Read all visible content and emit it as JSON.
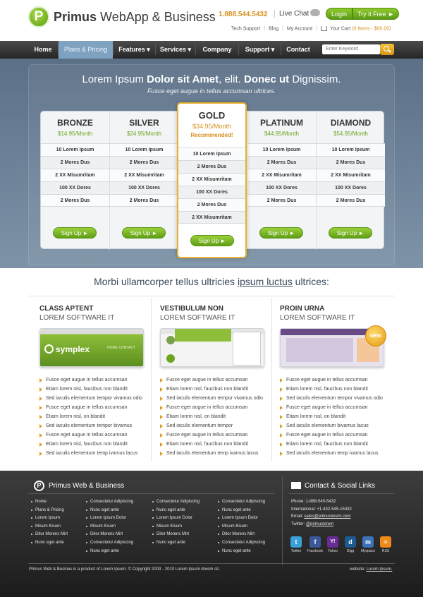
{
  "header": {
    "logo_letter": "P",
    "logo_bold": "Primus",
    "logo_rest": " WebApp & Business",
    "phone": "1.888.544.5432",
    "live_chat": "Live Chat",
    "login": "Login",
    "try_free": "Try it Free ►",
    "links": [
      "Tech Support",
      "Blog",
      "My Account"
    ],
    "cart_label": "Your Cart",
    "cart_count": "(0 Items - $00.00)"
  },
  "nav": {
    "items": [
      "Home",
      "Plans & Pricing",
      "Features ▾",
      "Services ▾",
      "Company",
      "Support ▾",
      "Contact"
    ],
    "search_placeholder": "Enter Keyword"
  },
  "hero": {
    "title_part1": "Lorem Ipsum ",
    "title_bold1": "Dolor sit Amet",
    "title_part2": ", elit. ",
    "title_bold2": "Donec ut",
    "title_part3": " Dignissim.",
    "subtitle": "Fusce eget augue in tellus accumsan ultrices."
  },
  "plans": [
    {
      "name": "BRONZE",
      "price": "$14.95/Month",
      "rows": [
        "10 Lorem Ipsum",
        "2 Mores Dus",
        "2 XX Misumritam",
        "100 XX Dores",
        "2 Mores Dus"
      ],
      "button": "Sign Up ►"
    },
    {
      "name": "SILVER",
      "price": "$24.95/Month",
      "rows": [
        "10 Lorem Ipsum",
        "2 Mores Dus",
        "2 XX Misumritam",
        "100 XX Dores",
        "2 Mores Dus"
      ],
      "button": "Sign Up ►"
    },
    {
      "name": "PLATINUM",
      "price": "$44.95/Month",
      "rows": [
        "10 Lorem Ipsum",
        "2 Mores Dus",
        "2 XX Misumritam",
        "100 XX Dores",
        "2 Mores Dus"
      ],
      "button": "Sign Up ►"
    },
    {
      "name": "DIAMOND",
      "price": "$54.95/Month",
      "rows": [
        "10 Lorem Ipsum",
        "2 Mores Dus",
        "2 XX Misumritam",
        "100 XX Dores",
        "2 Mores Dus"
      ],
      "button": "Sign Up ►"
    }
  ],
  "gold": {
    "name": "GOLD",
    "price": "$34.95/Month",
    "recommended": "Recommended!",
    "rows": [
      "10 Lorem Ipsum",
      "2 Mores Dus",
      "2 XX Misumritam",
      "100 XX Dores",
      "2 Mores Dus",
      "2 XX Misumritam"
    ],
    "button": "Sign Up ►"
  },
  "features": {
    "title_part1": "Morbi ullamcorper tellus ultricies ",
    "title_link": "ipsum luctus",
    "title_part2": " ultrices:",
    "columns": [
      {
        "h1": "CLASS APTENT",
        "h2": "LOREM SOFTWARE IT",
        "shot_brand": "symplex",
        "shot_nav": "HOME   CONTACT",
        "items": [
          "Fusce eget augue in tellus accumsan",
          "Etiam lorem nisl, faucibus non blandit",
          "Sed iaculis elementum tempor vivamus odio",
          "Fusce eget augue in tellus accumsan",
          "Etiam lorem nisl, on blandit",
          "Sed iaculis elementum tempor bivamus",
          "Fusce eget augue in tellus accumsan",
          "Etiam lorem nisl, faucibus non blandit",
          "Sed iaculis elementum temp ivamus lacus"
        ]
      },
      {
        "h1": "VESTIBULUM NON",
        "h2": "LOREM SOFTWARE IT",
        "items": [
          "Fusce eget augue in tellus accumsan",
          "Etiam lorem nisl, faucibus non blandit",
          "Sed iaculis elementum tempor vivamus odio",
          "Fusce eget augue in tellus accumsan",
          "Etiam lorem nisl, on blandit",
          "Sed iaculis elementum tempor",
          "Fusce eget augue in tellus accumsan",
          "Etiam lorem nisl, faucibus non blandit",
          "Sed iaculis elementum temp ivamus lacus"
        ]
      },
      {
        "h1": "PROIN URNA",
        "h2": "LOREM SOFTWARE IT",
        "badge": "NEW",
        "items": [
          "Fusce eget augue in tellus accumsan",
          "Etiam lorem nisl, faucibus non blandit",
          "Sed iaculis elementum tempor vivamus odio",
          "Fusce eget augue in tellus accumsan",
          "Etiam lorem nisl, on blandit",
          "Sed iaculis elementum bivamus  lacus",
          "Fusce eget augue in tellus accumsan",
          "Etiam lorem nisl, faucibus non blandit",
          "Sed iaculis elementum temp ivamus lacus"
        ]
      }
    ]
  },
  "footer": {
    "logo_letter": "P",
    "title": "Primus Web & Business",
    "contact_title": "Contact & Social Links",
    "col1": [
      "Home",
      "Plans & Pricing",
      "Lorem Ipsum",
      "Misum Kisum",
      "Ditor Morens Mirt",
      "Nunc eget ante"
    ],
    "col2": [
      "Consectetur Adipiscing",
      "Nunc eget ante",
      "Lorem Ipsum Dolor",
      "Misum Kisum",
      "Ditor Morens Mirt",
      "Consectetur Adipiscing",
      "Nunc eget ante"
    ],
    "col3": [
      "Consectetur Adipiscing",
      "Nunc eget ante",
      "Lorem Ipsum Dolor",
      "Misum Kisum",
      "Ditor Morens Mirt",
      "Nunc eget ante"
    ],
    "col4": [
      "Consectetur Adipiscing",
      "Nunc eget ante",
      "Lorem Ipsum Dolor",
      "Misum Kisum",
      "Ditor Morens Mirt",
      "Consectetur Adipiscing",
      "Nunc eget ante"
    ],
    "phone": "Phone: 1-888-545-5432",
    "international": "International: +1-432-545-15432",
    "email_label": "Email: ",
    "email": "sales@primuslorem.com",
    "twitter_label": "Twitter: ",
    "twitter": "@primuslorem",
    "social": [
      {
        "label": "Twitter",
        "glyph": "t",
        "color": "#3aa0d8"
      },
      {
        "label": "Facebook",
        "glyph": "f",
        "color": "#3b5998"
      },
      {
        "label": "Yahoo",
        "glyph": "Y!",
        "color": "#6b2b95"
      },
      {
        "label": "Digg",
        "glyph": "d",
        "color": "#1c5a8f"
      },
      {
        "label": "Myspace",
        "glyph": "m",
        "color": "#3b72b8"
      },
      {
        "label": "RSS",
        "glyph": "≈",
        "color": "#ee8a1a"
      }
    ],
    "copyright": "Primus Web & Busines is a product of Lorem Ipsum. © Copyright 2003 - 2010 Lorem Ipsum dorem sit.",
    "website_label": "website: ",
    "website": "Lorem Ipsum."
  }
}
